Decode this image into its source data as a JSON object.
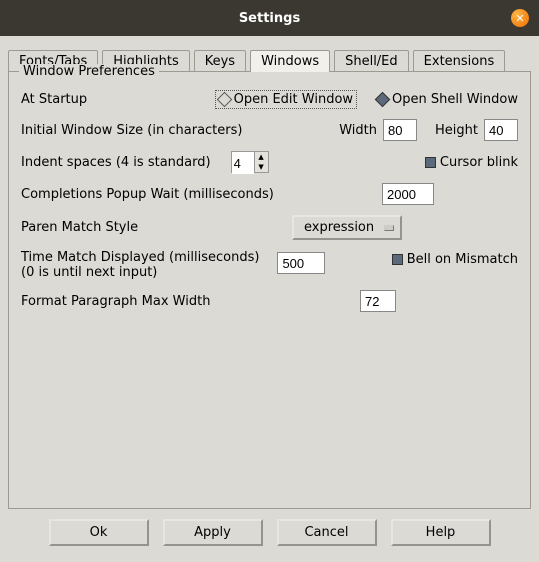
{
  "window": {
    "title": "Settings"
  },
  "tabs": {
    "fonts": "Fonts/Tabs",
    "highlights": "Highlights",
    "keys": "Keys",
    "windows": "Windows",
    "shelled": "Shell/Ed",
    "extensions": "Extensions"
  },
  "group": {
    "title": "Window Preferences"
  },
  "startup": {
    "label": "At Startup",
    "open_edit": "Open Edit Window",
    "open_shell": "Open Shell Window"
  },
  "size": {
    "label": "Initial Window Size  (in characters)",
    "width_label": "Width",
    "width_value": "80",
    "height_label": "Height",
    "height_value": "40"
  },
  "indent": {
    "label": "Indent spaces (4 is standard)",
    "value": "4"
  },
  "cursor": {
    "label": "Cursor blink"
  },
  "completions": {
    "label": "Completions Popup Wait (milliseconds)",
    "value": "2000"
  },
  "paren": {
    "label": "Paren Match Style",
    "value": "expression"
  },
  "time_match": {
    "label": "Time Match Displayed (milliseconds)",
    "sub": "(0 is until next input)",
    "value": "500",
    "bell": "Bell on Mismatch"
  },
  "format": {
    "label": "Format Paragraph Max Width",
    "value": "72"
  },
  "buttons": {
    "ok": "Ok",
    "apply": "Apply",
    "cancel": "Cancel",
    "help": "Help"
  }
}
